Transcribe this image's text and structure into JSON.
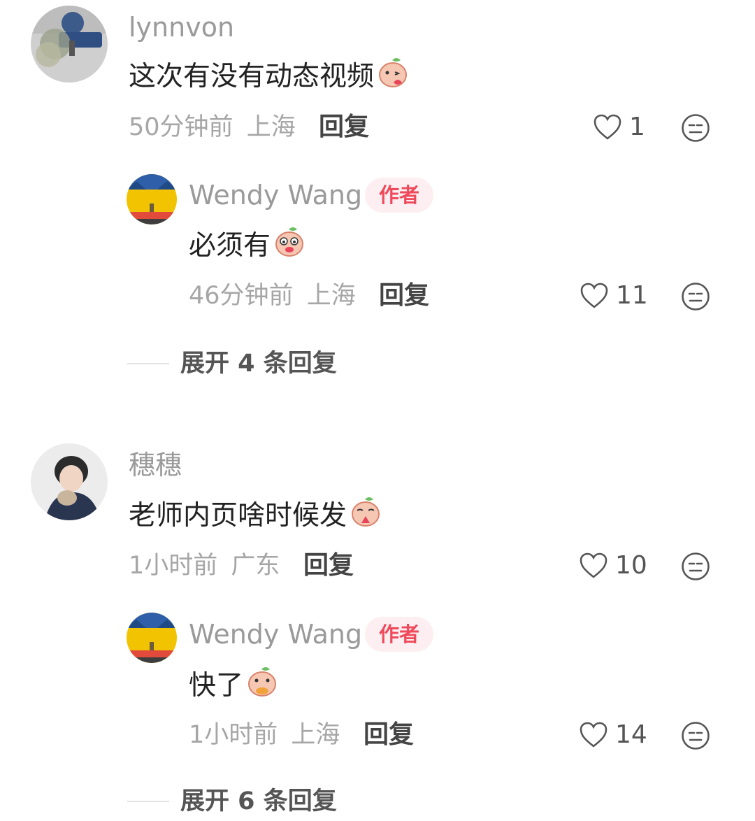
{
  "comments": [
    {
      "username": "lynnvon",
      "text": "这次有没有动态视频",
      "time": "50分钟前",
      "location": "上海",
      "reply_label": "回复",
      "likes": "1",
      "replies": [
        {
          "username": "Wendy Wang",
          "badge": "作者",
          "text": "必须有",
          "time": "46分钟前",
          "location": "上海",
          "reply_label": "回复",
          "likes": "11"
        }
      ],
      "expand_label": "展开 4 条回复"
    },
    {
      "username": "穗穗",
      "text": "老师内页啥时候发",
      "time": "1小时前",
      "location": "广东",
      "reply_label": "回复",
      "likes": "10",
      "replies": [
        {
          "username": "Wendy Wang",
          "badge": "作者",
          "text": "快了",
          "time": "1小时前",
          "location": "上海",
          "reply_label": "回复",
          "likes": "14"
        }
      ],
      "expand_label": "展开 6 条回复"
    }
  ],
  "icons": {
    "like": "heart-outline-icon",
    "dislike": "neutral-face-icon"
  },
  "colors": {
    "author_badge_bg": "#fdeff1",
    "author_badge_text": "#ef4a5c",
    "secondary_text": "#a6a6a6"
  }
}
